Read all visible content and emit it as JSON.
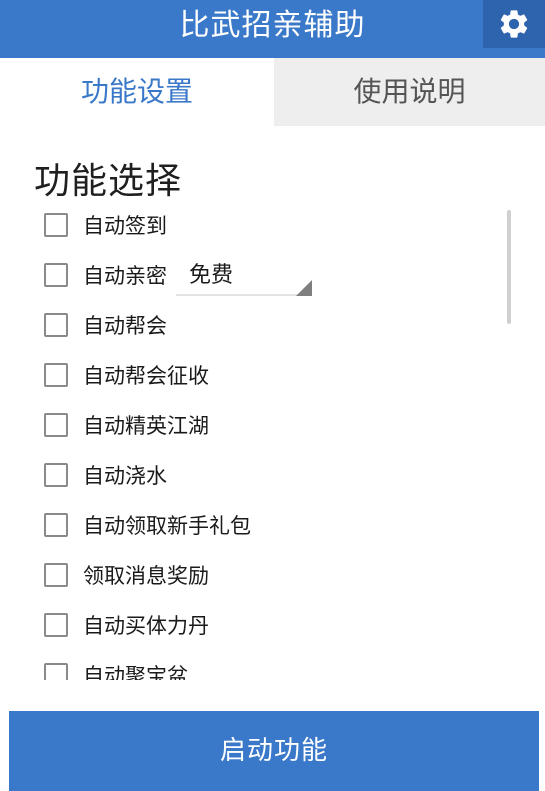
{
  "app": {
    "title": "比武招亲辅助"
  },
  "tabs": [
    {
      "label": "功能设置",
      "active": true
    },
    {
      "label": "使用说明",
      "active": false
    }
  ],
  "section": {
    "title": "功能选择"
  },
  "options": [
    {
      "label": "自动签到",
      "checked": false
    },
    {
      "label": "自动亲密",
      "checked": false,
      "select": {
        "value": "免费"
      }
    },
    {
      "label": "自动帮会",
      "checked": false
    },
    {
      "label": "自动帮会征收",
      "checked": false
    },
    {
      "label": "自动精英江湖",
      "checked": false
    },
    {
      "label": "自动浇水",
      "checked": false
    },
    {
      "label": "自动领取新手礼包",
      "checked": false
    },
    {
      "label": "领取消息奖励",
      "checked": false
    },
    {
      "label": "自动买体力丹",
      "checked": false
    },
    {
      "label": "自动聚宝盆",
      "checked": false
    }
  ],
  "footer": {
    "start_label": "启动功能"
  },
  "icons": {
    "settings": "gear-icon"
  },
  "colors": {
    "primary": "#3a78c9",
    "primary_dark": "#2d64ad",
    "inactive_tab": "#eeeeee"
  }
}
